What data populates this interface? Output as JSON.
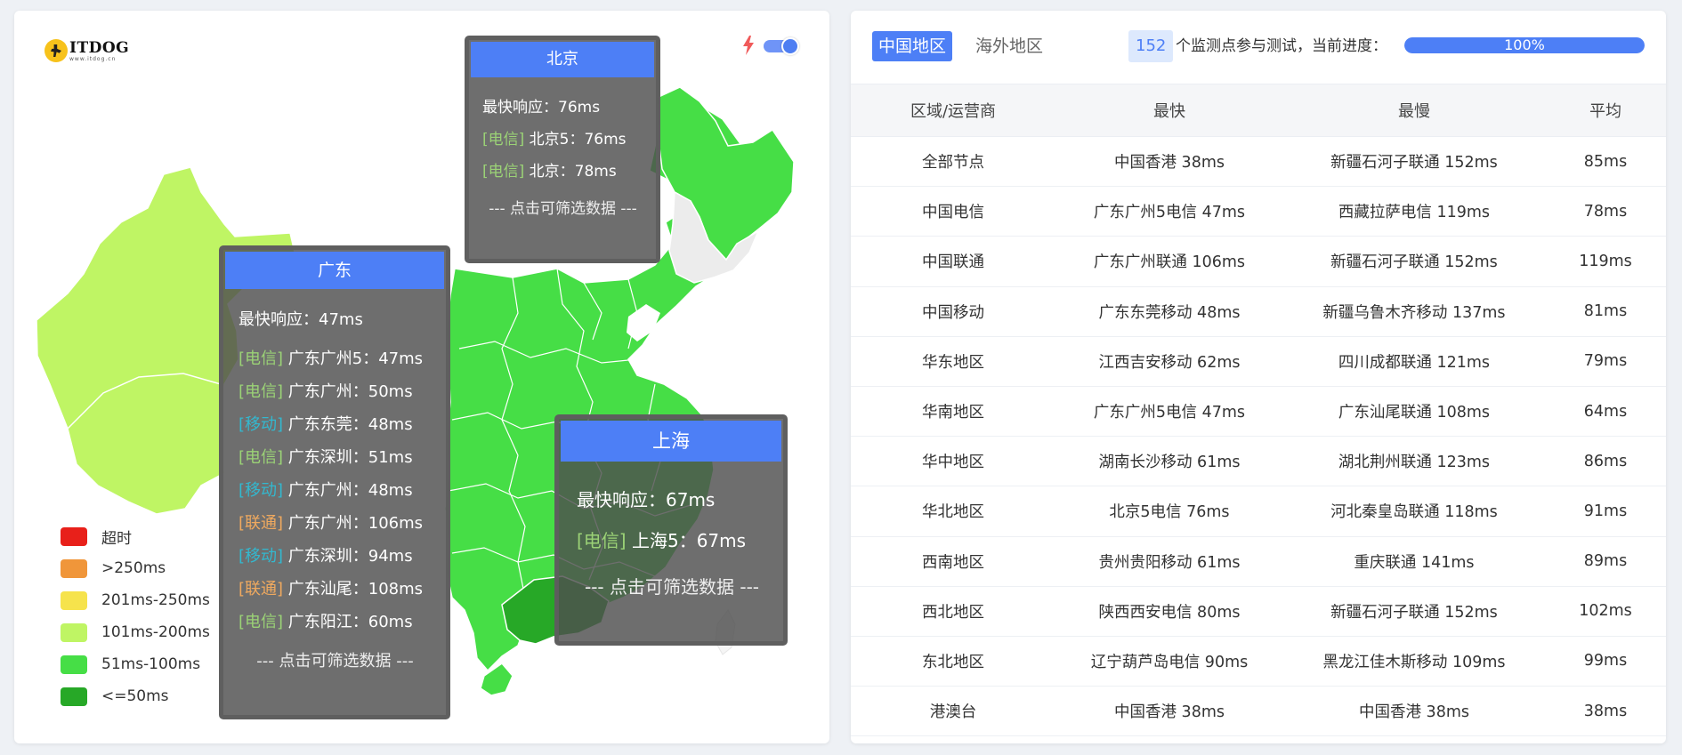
{
  "logo": {
    "title": "ITDOG",
    "subtitle": "www.itdog.cn"
  },
  "icons": {
    "bolt": "bolt-icon",
    "logo": "dog-logo-icon"
  },
  "map": {
    "toggle_on": true,
    "legend": [
      {
        "label": "超时",
        "color": "#e8201a"
      },
      {
        "label": ">250ms",
        "color": "#f0963a"
      },
      {
        "label": "201ms-250ms",
        "color": "#f6e34c"
      },
      {
        "label": "101ms-200ms",
        "color": "#bff564"
      },
      {
        "label": "51ms-100ms",
        "color": "#46de46"
      },
      {
        "label": "<=50ms",
        "color": "#27a827"
      }
    ],
    "tooltips": {
      "beijing": {
        "title": "北京",
        "fastest": "最快响应：76ms",
        "lines": [
          {
            "tag": "[电信]",
            "text": " 北京5：76ms",
            "kind": "dx"
          },
          {
            "tag": "[电信]",
            "text": " 北京：78ms",
            "kind": "dx"
          }
        ],
        "footer": "--- 点击可筛选数据 ---"
      },
      "guangdong": {
        "title": "广东",
        "fastest": "最快响应：47ms",
        "lines": [
          {
            "tag": "[电信]",
            "text": " 广东广州5：47ms",
            "kind": "dx"
          },
          {
            "tag": "[电信]",
            "text": " 广东广州：50ms",
            "kind": "dx"
          },
          {
            "tag": "[移动]",
            "text": " 广东东莞：48ms",
            "kind": "yd"
          },
          {
            "tag": "[电信]",
            "text": " 广东深圳：51ms",
            "kind": "dx"
          },
          {
            "tag": "[移动]",
            "text": " 广东广州：48ms",
            "kind": "yd"
          },
          {
            "tag": "[联通]",
            "text": " 广东广州：106ms",
            "kind": "lt"
          },
          {
            "tag": "[移动]",
            "text": " 广东深圳：94ms",
            "kind": "yd"
          },
          {
            "tag": "[联通]",
            "text": " 广东汕尾：108ms",
            "kind": "lt"
          },
          {
            "tag": "[电信]",
            "text": " 广东阳江：60ms",
            "kind": "dx"
          }
        ],
        "footer": "--- 点击可筛选数据 ---"
      },
      "shanghai": {
        "title": "上海",
        "fastest": "最快响应：67ms",
        "lines": [
          {
            "tag": "[电信]",
            "text": " 上海5：67ms",
            "kind": "dx"
          }
        ],
        "footer": "--- 点击可筛选数据 ---"
      }
    }
  },
  "results": {
    "tabs": {
      "active": "中国地区",
      "inactive": "海外地区"
    },
    "monitor_count": "152",
    "monitor_text": "个监测点参与测试，当前进度：",
    "progress": {
      "label": "100%",
      "value": 1.0
    },
    "columns": [
      "区域/运营商",
      "最快",
      "最慢",
      "平均"
    ],
    "rows": [
      [
        "全部节点",
        "中国香港 38ms",
        "新疆石河子联通 152ms",
        "85ms"
      ],
      [
        "中国电信",
        "广东广州5电信 47ms",
        "西藏拉萨电信 119ms",
        "78ms"
      ],
      [
        "中国联通",
        "广东广州联通 106ms",
        "新疆石河子联通 152ms",
        "119ms"
      ],
      [
        "中国移动",
        "广东东莞移动 48ms",
        "新疆乌鲁木齐移动 137ms",
        "81ms"
      ],
      [
        "华东地区",
        "江西吉安移动 62ms",
        "四川成都联通 121ms",
        "79ms"
      ],
      [
        "华南地区",
        "广东广州5电信 47ms",
        "广东汕尾联通 108ms",
        "64ms"
      ],
      [
        "华中地区",
        "湖南长沙移动 61ms",
        "湖北荆州联通 123ms",
        "86ms"
      ],
      [
        "华北地区",
        "北京5电信 76ms",
        "河北秦皇岛联通 118ms",
        "91ms"
      ],
      [
        "西南地区",
        "贵州贵阳移动 61ms",
        "重庆联通 141ms",
        "89ms"
      ],
      [
        "西北地区",
        "陕西西安电信 80ms",
        "新疆石河子联通 152ms",
        "102ms"
      ],
      [
        "东北地区",
        "辽宁葫芦岛电信 90ms",
        "黑龙江佳木斯移动 109ms",
        "99ms"
      ],
      [
        "港澳台",
        "中国香港 38ms",
        "中国香港 38ms",
        "38ms"
      ]
    ]
  }
}
